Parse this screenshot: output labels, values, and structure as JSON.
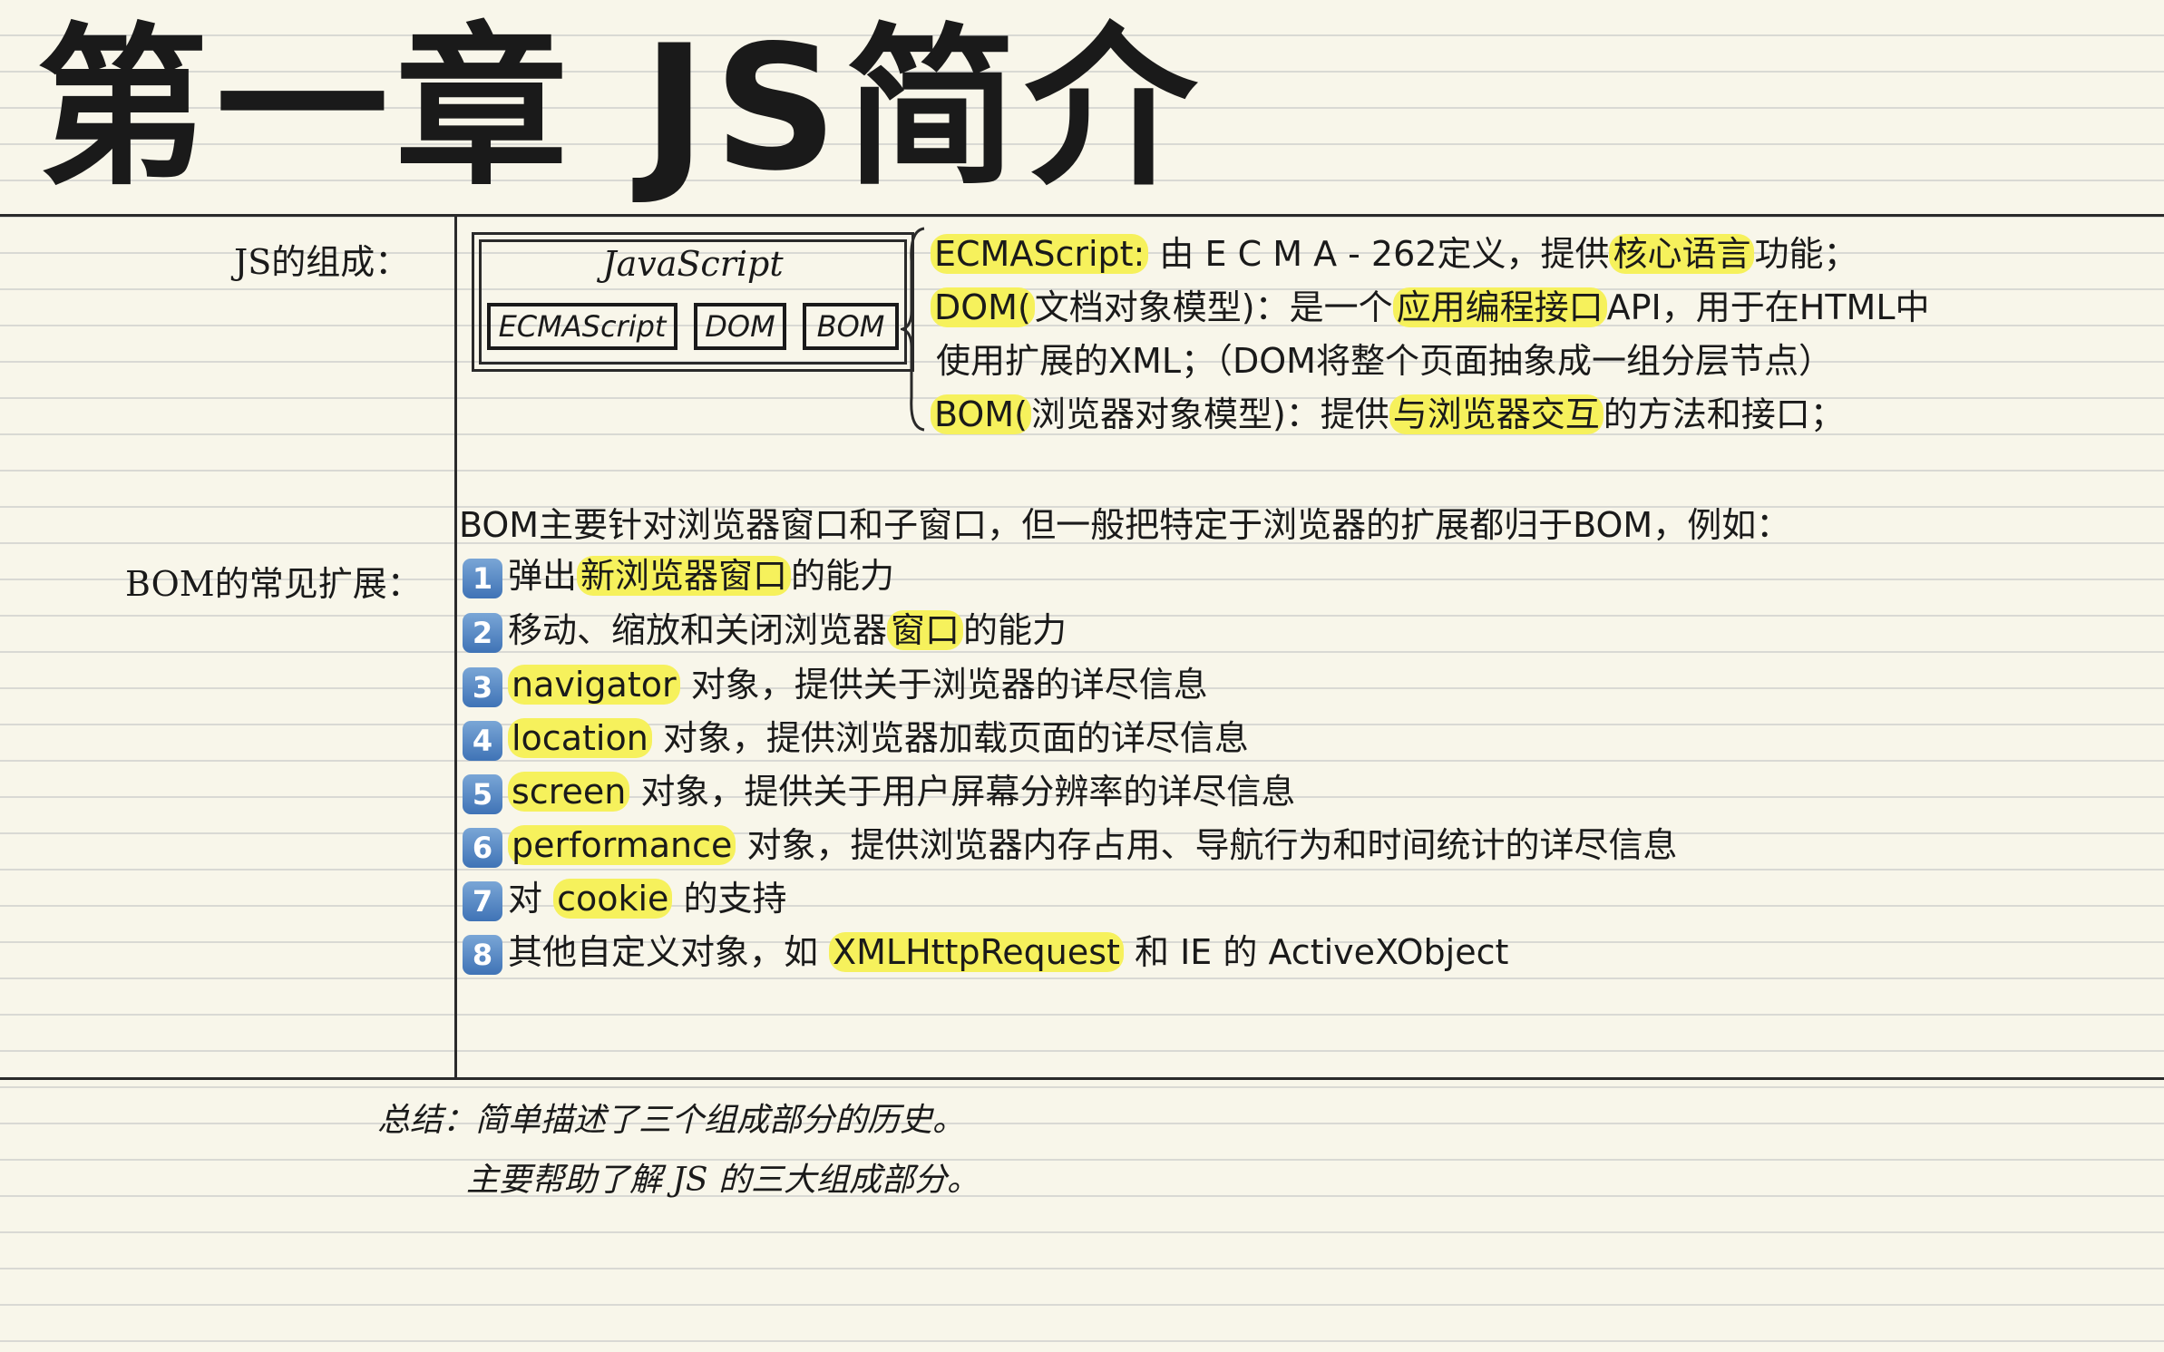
{
  "title": "第一章 JS简介",
  "js_composition": {
    "label": "JS的组成：",
    "diagram": {
      "outer": "JavaScript",
      "parts": [
        "ECMAScript",
        "DOM",
        "BOM"
      ]
    },
    "lines": [
      {
        "hl": "ECMAScript:",
        "text": " 由 E C M A - 262定义，提供",
        "hl2": "核心语言",
        "tail": "功能；"
      },
      {
        "hl": "DOM(",
        "text": "文档对象模型)：是一个",
        "hl2": "应用编程接口",
        "tail": "API，用于在HTML中"
      },
      {
        "hl": "",
        "text": "使用扩展的XML；（DOM将整个页面抽象成一组分层节点）",
        "hl2": "",
        "tail": ""
      },
      {
        "hl": "BOM(",
        "text": "浏览器对象模型)：提供",
        "hl2": "与浏览器交互",
        "tail": "的方法和接口；"
      }
    ]
  },
  "bom_section": {
    "label": "BOM的常见扩展：",
    "intro": "BOM主要针对浏览器窗口和子窗口，但一般把特定于浏览器的扩展都归于BOM，例如：",
    "items": [
      {
        "num": "1",
        "pre": "弹出",
        "hl": "新浏览器窗口",
        "post": "的能力"
      },
      {
        "num": "2",
        "pre": "移动、缩放和关闭浏览器",
        "hl": "窗口",
        "post": "的能力"
      },
      {
        "num": "3",
        "pre": "",
        "hl": "navigator",
        "post": " 对象，提供关于浏览器的详尽信息"
      },
      {
        "num": "4",
        "pre": "",
        "hl": "location",
        "post": " 对象，提供浏览器加载页面的详尽信息"
      },
      {
        "num": "5",
        "pre": "",
        "hl": "screen",
        "post": " 对象，提供关于用户屏幕分辨率的详尽信息"
      },
      {
        "num": "6",
        "pre": "",
        "hl": "performance",
        "post": " 对象，提供浏览器内存占用、导航行为和时间统计的详尽信息"
      },
      {
        "num": "7",
        "pre": "对 ",
        "hl": "cookie",
        "post": " 的支持"
      },
      {
        "num": "8",
        "pre": "其他自定义对象，如 ",
        "hl": "XMLHttpRequest",
        "post": " 和 IE 的 ActiveXObject"
      }
    ]
  },
  "summary": {
    "label": "总结：",
    "line1": "简单描述了三个组成部分的历史。",
    "line2": "主要帮助了解 JS 的三大组成部分。"
  }
}
